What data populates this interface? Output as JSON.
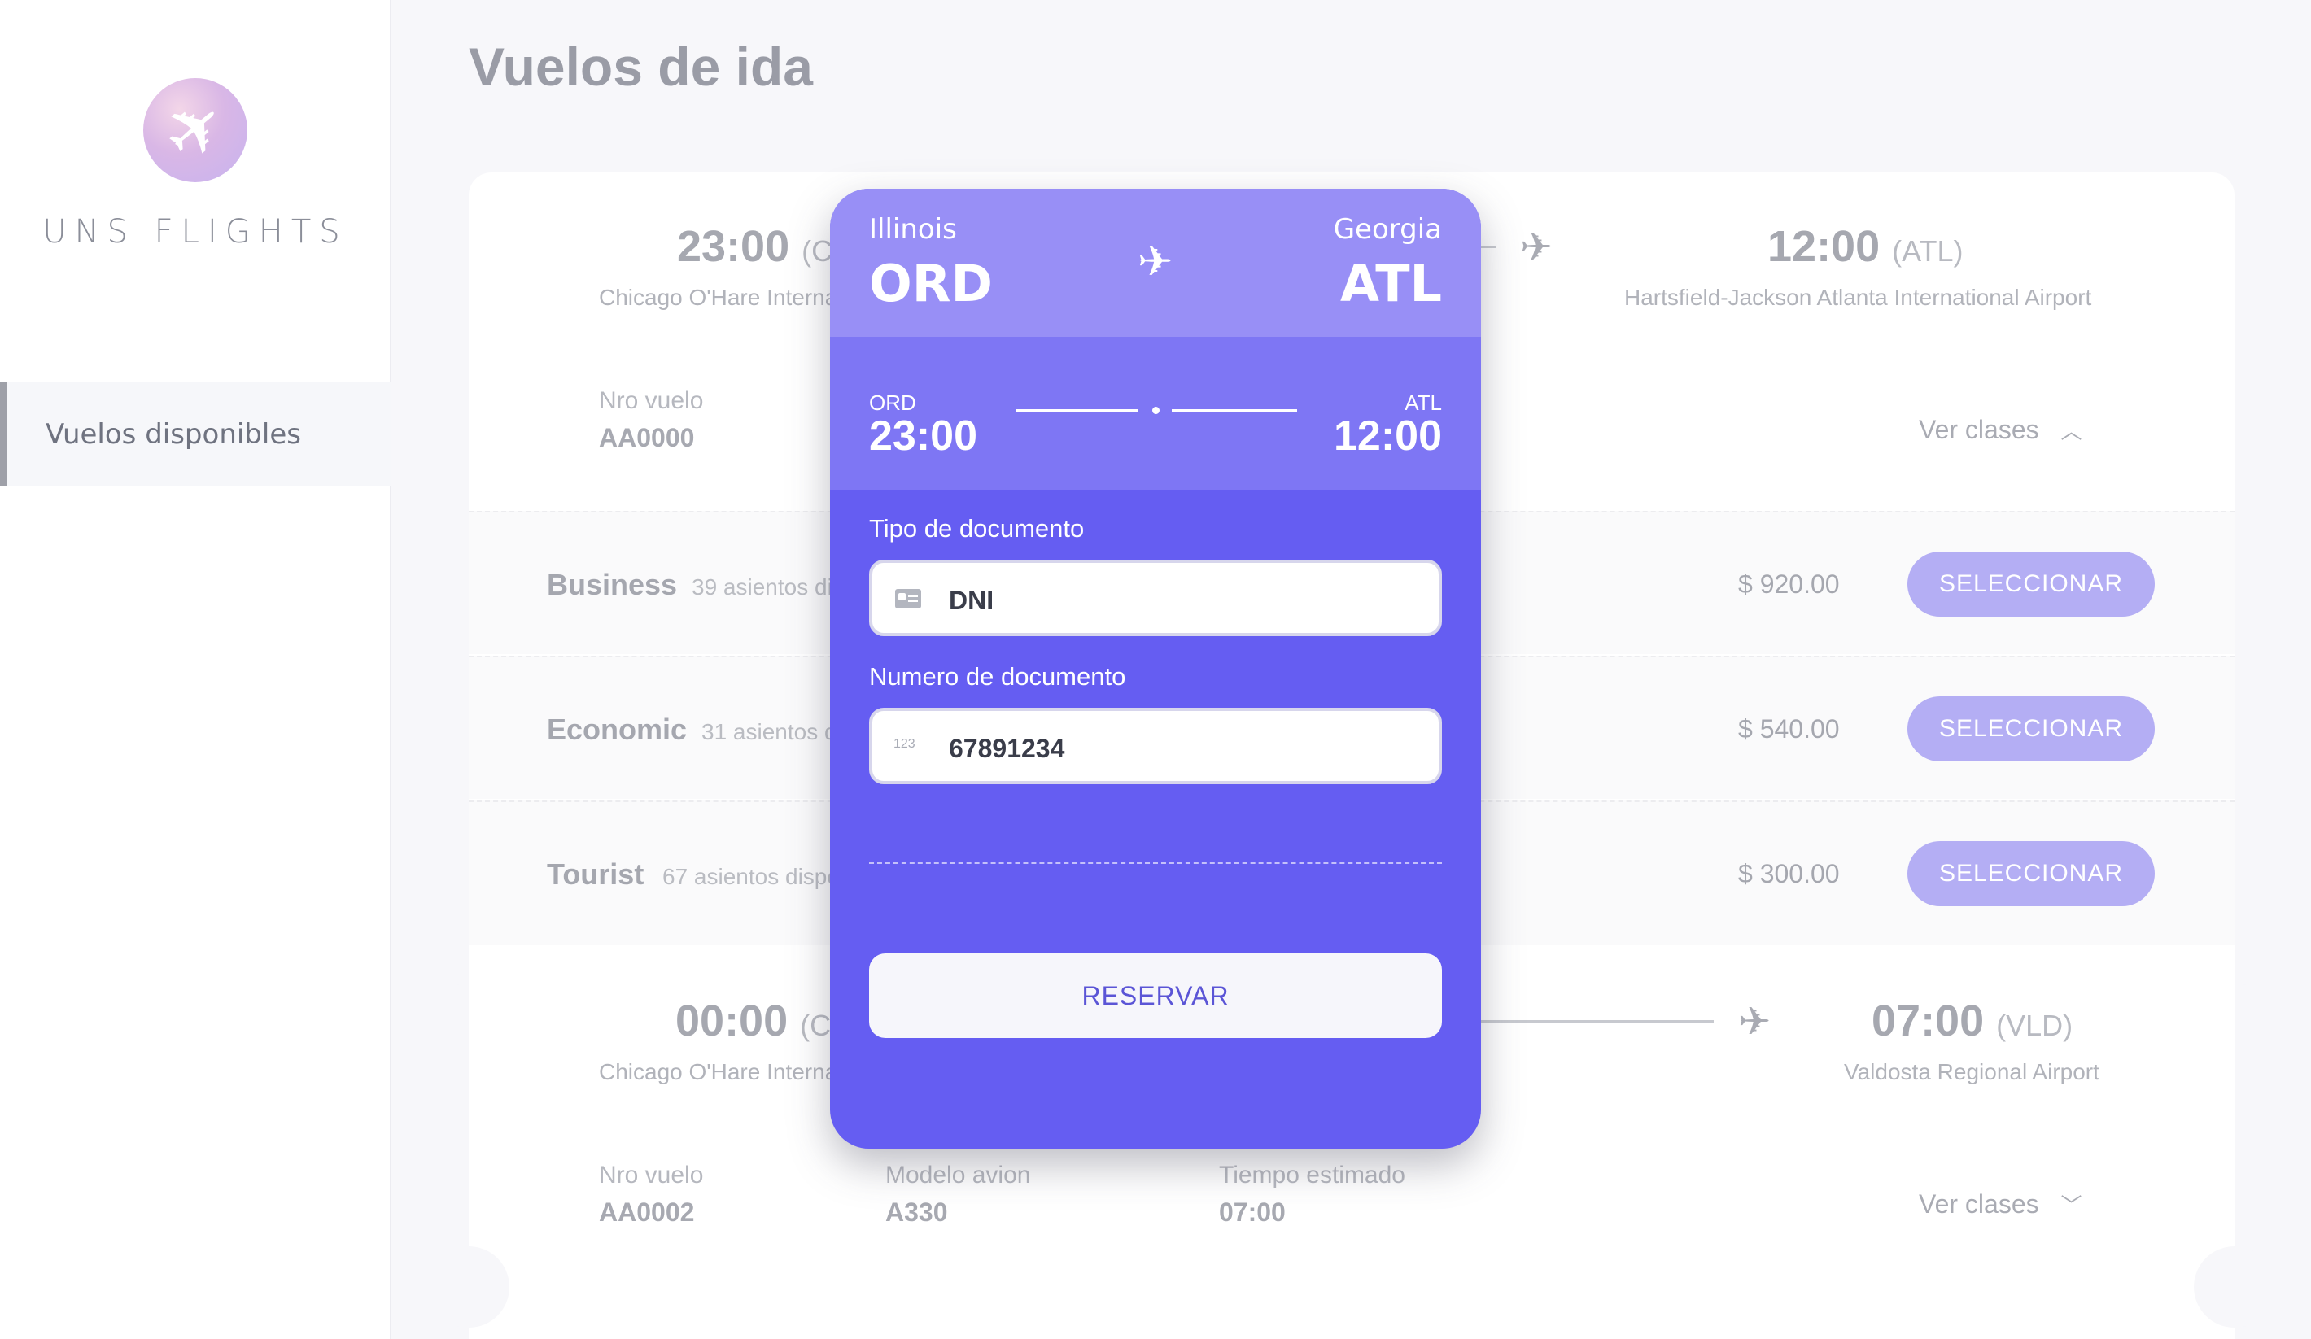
{
  "sidebar": {
    "brand": "UNS FLIGHTS",
    "logo_icon": "airplane-icon",
    "nav_item": "Vuelos disponibles"
  },
  "page": {
    "title": "Vuelos de ida"
  },
  "flight1": {
    "departure_time": "23:00",
    "departure_code_partial": "(C",
    "departure_airport": "Chicago O'Hare Interna",
    "arrival_time": "12:00",
    "arrival_code": "(ATL)",
    "arrival_airport": "Hartsfield-Jackson Atlanta International Airport",
    "flight_label": "Nro vuelo",
    "flight_number": "AA0000",
    "classes_link": "Ver clases",
    "classes": [
      {
        "name": "Business",
        "seats": "39 asientos di",
        "price": "$ 920.00",
        "button": "SELECCIONAR"
      },
      {
        "name": "Economic",
        "seats": "31 asientos d",
        "price": "$ 540.00",
        "button": "SELECCIONAR"
      },
      {
        "name": "Tourist",
        "seats": "67 asientos dispo",
        "price": "$ 300.00",
        "button": "SELECCIONAR"
      }
    ]
  },
  "flight2": {
    "departure_time": "00:00",
    "departure_code_partial": "(C",
    "departure_airport": "Chicago O'Hare Interna",
    "arrival_time": "07:00",
    "arrival_code": "(VLD)",
    "arrival_airport": "Valdosta Regional Airport",
    "flight_label": "Nro vuelo",
    "flight_number": "AA0002",
    "model_label": "Modelo avion",
    "model": "A330",
    "duration_label": "Tiempo estimado",
    "duration": "07:00",
    "classes_link": "Ver clases"
  },
  "modal": {
    "origin_state": "Illinois",
    "origin_code": "ORD",
    "destination_state": "Georgia",
    "destination_code": "ATL",
    "origin_small": "ORD",
    "origin_time": "23:00",
    "destination_small": "ATL",
    "destination_time": "12:00",
    "doc_type_label": "Tipo de documento",
    "doc_type_value": "DNI",
    "doc_number_label": "Numero de documento",
    "doc_number_value": "67891234",
    "doc_number_icon_text": "123",
    "reserve_button": "RESERVAR"
  },
  "colors": {
    "accent": "#655df2",
    "accent_light": "#988ff6",
    "accent_mid": "#7e76f4",
    "select_button": "#b4aef4"
  }
}
